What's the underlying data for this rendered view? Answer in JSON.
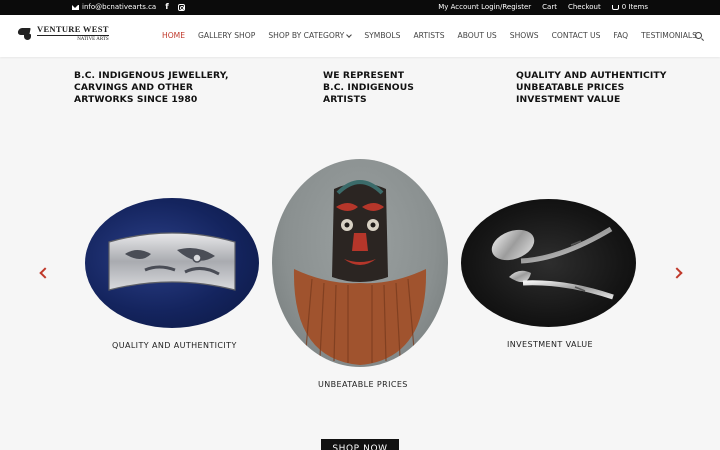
{
  "topbar": {
    "email": "info@bcnativearts.ca",
    "facebook_icon": "f",
    "links": [
      "My Account Login/Register",
      "Cart",
      "Checkout"
    ],
    "cart_items": "0 Items"
  },
  "logo": {
    "name": "VENTURE WEST",
    "sub": "NATIVE ARTS"
  },
  "nav": {
    "items": [
      "HOME",
      "GALLERY SHOP",
      "SHOP BY CATEGORY",
      "SYMBOLS",
      "ARTISTS",
      "ABOUT US",
      "SHOWS",
      "CONTACT US",
      "FAQ",
      "TESTIMONIALS"
    ],
    "active": "HOME"
  },
  "taglines": [
    [
      "B.C. INDIGENOUS JEWELLERY,",
      "CARVINGS AND OTHER",
      "ARTWORKS SINCE 1980"
    ],
    [
      "WE REPRESENT",
      "B.C. INDIGENOUS",
      "ARTISTS"
    ],
    [
      "QUALITY AND AUTHENTICITY",
      "UNBEATABLE PRICES",
      "INVESTMENT VALUE"
    ]
  ],
  "carousel": {
    "slides": [
      {
        "caption": "QUALITY AND AUTHENTICITY",
        "image": "carved silver bracelet"
      },
      {
        "caption": "UNBEATABLE PRICES",
        "image": "carved wooden mask with cedar bark"
      },
      {
        "caption": "INVESTMENT VALUE",
        "image": "engraved silver salad servers"
      }
    ]
  },
  "cta": {
    "label": "SHOP NOW"
  },
  "colors": {
    "accent": "#c0392b",
    "topbar": "#0b0b0b",
    "background": "#f6f6f6"
  }
}
